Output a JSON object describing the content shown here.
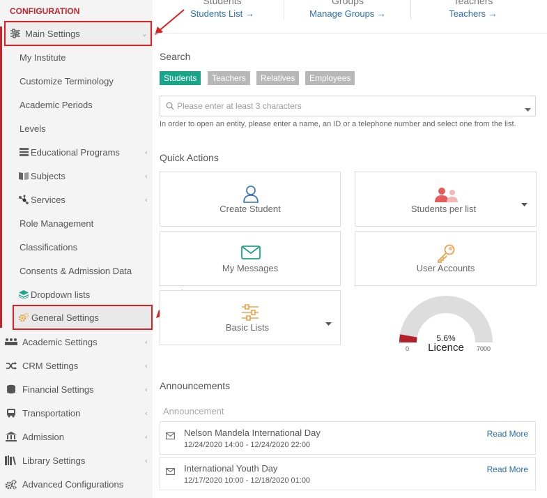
{
  "sidebar": {
    "title": "CONFIGURATION",
    "main_settings": {
      "label": "Main Settings",
      "icon": "sliders-icon"
    },
    "items": [
      {
        "label": "My Institute"
      },
      {
        "label": "Customize Terminology"
      },
      {
        "label": "Academic Periods"
      },
      {
        "label": "Levels"
      },
      {
        "label": "Educational Programs",
        "icon": "server-icon"
      },
      {
        "label": "Subjects",
        "icon": "book-icon"
      },
      {
        "label": "Services",
        "icon": "nodes-icon"
      },
      {
        "label": "Role Management"
      },
      {
        "label": "Classifications"
      },
      {
        "label": "Consents & Admission Data"
      },
      {
        "label": "Dropdown lists",
        "icon": "layers-icon"
      }
    ],
    "general_settings": {
      "label": "General Settings",
      "icon": "gears-icon"
    },
    "sections": [
      {
        "label": "Academic Settings",
        "icon": "people-icon"
      },
      {
        "label": "CRM Settings",
        "icon": "shuffle-icon"
      },
      {
        "label": "Financial Settings",
        "icon": "coins-icon"
      },
      {
        "label": "Transportation",
        "icon": "bus-icon"
      },
      {
        "label": "Admission",
        "icon": "bank-icon"
      },
      {
        "label": "Library Settings",
        "icon": "library-icon"
      },
      {
        "label": "Advanced Configurations",
        "icon": "cogs-icon"
      }
    ]
  },
  "topnav": {
    "cols": [
      {
        "head": "Students",
        "link": "Students List →"
      },
      {
        "head": "Groups",
        "link": "Manage Groups →"
      },
      {
        "head": "Teachers",
        "link": "Teachers →"
      }
    ]
  },
  "search": {
    "title": "Search",
    "tabs": [
      "Students",
      "Teachers",
      "Relatives",
      "Employees"
    ],
    "placeholder": "Please enter at least 3 characters",
    "help": "In order to open an entity, please enter a name, an ID or a telephone number and select one from the list."
  },
  "quick_actions": {
    "title": "Quick Actions",
    "create_student": "Create Student",
    "students_per_list": "Students per list",
    "my_messages": "My Messages",
    "user_accounts": "User Accounts",
    "basic_lists": "Basic Lists"
  },
  "licence": {
    "percent_text": "5.6%",
    "label": "Licence",
    "min": "0",
    "max": "7000",
    "fraction": 0.056
  },
  "announcements": {
    "title": "Announcements",
    "header": "Announcement",
    "items": [
      {
        "title": "Nelson Mandela International Day",
        "date": "12/24/2020 14:00 - 12/24/2020 22:00",
        "read": "Read More"
      },
      {
        "title": "International Youth Day",
        "date": "12/17/2020 10:00 - 12/18/2020 01:00",
        "read": "Read More"
      }
    ]
  },
  "colors": {
    "accent_red": "#c0272d",
    "active_tab": "#1aa58a",
    "inactive_tab": "#b8b8b8",
    "link_blue": "#2a6fb3",
    "gauge_fill": "#b3202a",
    "gauge_track": "#dddddd"
  }
}
